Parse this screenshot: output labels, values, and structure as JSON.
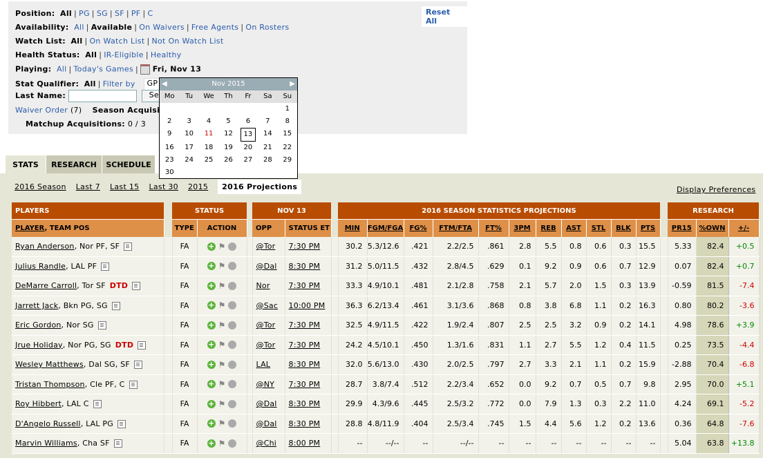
{
  "filters": {
    "position": {
      "label": "Position:",
      "current": "All",
      "options": [
        "PG",
        "SG",
        "SF",
        "PF",
        "C"
      ]
    },
    "availability": {
      "label": "Availability:",
      "all": "All",
      "current": "Available",
      "options": [
        "On Waivers",
        "Free Agents",
        "On Rosters"
      ]
    },
    "watch": {
      "label": "Watch List:",
      "current": "All",
      "options": [
        "On Watch List",
        "Not On Watch List"
      ]
    },
    "health": {
      "label": "Health Status:",
      "current": "All",
      "options": [
        "IR-Eligible",
        "Healthy"
      ]
    },
    "playing": {
      "label": "Playing:",
      "all": "All",
      "today": "Today's Games",
      "date": "Fri, Nov 13"
    },
    "qualifier": {
      "label": "Stat Qualifier:",
      "current": "All",
      "filter": "Filter by",
      "select": "GP"
    },
    "lastname": {
      "label": "Last Name:",
      "value": "",
      "button": "Search"
    },
    "waiver": {
      "link": "Waiver Order",
      "count": "(7)",
      "season": "Season Acquisitions"
    },
    "matchup": {
      "label": "Matchup Acquisitions:",
      "value": "0 / 3"
    },
    "reset": "Reset All"
  },
  "calendar": {
    "month": "Nov 2015",
    "days": [
      "Mo",
      "Tu",
      "We",
      "Th",
      "Fr",
      "Sa",
      "Su"
    ],
    "weeks": [
      [
        "",
        "",
        "",
        "",
        "",
        "",
        "1"
      ],
      [
        "2",
        "3",
        "4",
        "5",
        "6",
        "7",
        "8"
      ],
      [
        "9",
        "10",
        "11",
        "12",
        "13",
        "14",
        "15"
      ],
      [
        "16",
        "17",
        "18",
        "19",
        "20",
        "21",
        "22"
      ],
      [
        "23",
        "24",
        "25",
        "26",
        "27",
        "28",
        "29"
      ],
      [
        "30",
        "",
        "",
        "",
        "",
        "",
        ""
      ]
    ],
    "today": "11",
    "selected": "13"
  },
  "tabs": [
    "STATS",
    "RESEARCH",
    "SCHEDULE"
  ],
  "periods": [
    "2016 Season",
    "Last 7",
    "Last 15",
    "Last 30",
    "2015",
    "2016 Projections"
  ],
  "display_prefs": "Display Preferences",
  "groups": {
    "players": "PLAYERS",
    "status": "STATUS",
    "date": "NOV 13",
    "stats": "2016 SEASON STATISTICS PROJECTIONS",
    "research": "RESEARCH"
  },
  "headers": {
    "player": "PLAYER",
    "teampos": ", TEAM POS",
    "type": "TYPE",
    "action": "ACTION",
    "opp": "OPP",
    "status": "STATUS ET",
    "stats": [
      "MIN",
      "FGM/FGA",
      "FG%",
      "FTM/FTA",
      "FT%",
      "3PM",
      "REB",
      "AST",
      "STL",
      "BLK",
      "PTS"
    ],
    "research": [
      "PR15",
      "%OWN",
      "+/-"
    ]
  },
  "rows": [
    [
      "Ryan Anderson",
      ", Nor PF, SF",
      "",
      "FA",
      "@Tor",
      "7:30 PM",
      "30.2",
      "5.3/12.6",
      ".421",
      "2.2/2.5",
      ".861",
      "2.8",
      "5.5",
      "0.8",
      "0.6",
      "0.3",
      "15.5",
      "5.33",
      "82.4",
      "+0.5"
    ],
    [
      "Julius Randle",
      ", LAL PF",
      "",
      "FA",
      "@Dal",
      "8:30 PM",
      "31.2",
      "5.0/11.5",
      ".432",
      "2.8/4.5",
      ".629",
      "0.1",
      "9.2",
      "0.9",
      "0.6",
      "0.7",
      "12.9",
      "0.07",
      "82.4",
      "+0.7"
    ],
    [
      "DeMarre Carroll",
      ", Tor SF",
      "DTD",
      "FA",
      "Nor",
      "7:30 PM",
      "33.3",
      "4.9/10.1",
      ".481",
      "2.1/2.8",
      ".758",
      "2.1",
      "5.7",
      "2.0",
      "1.5",
      "0.3",
      "13.9",
      "-0.59",
      "81.5",
      "-7.4"
    ],
    [
      "Jarrett Jack",
      ", Bkn PG, SG",
      "",
      "FA",
      "@Sac",
      "10:00 PM",
      "36.3",
      "6.2/13.4",
      ".461",
      "3.1/3.6",
      ".868",
      "0.8",
      "3.8",
      "6.8",
      "1.1",
      "0.2",
      "16.3",
      "0.80",
      "80.2",
      "-3.6"
    ],
    [
      "Eric Gordon",
      ", Nor SG",
      "",
      "FA",
      "@Tor",
      "7:30 PM",
      "32.5",
      "4.9/11.5",
      ".422",
      "1.9/2.4",
      ".807",
      "2.5",
      "2.5",
      "3.2",
      "0.9",
      "0.2",
      "14.1",
      "4.98",
      "78.6",
      "+3.9"
    ],
    [
      "Jrue Holiday",
      ", Nor PG, SG",
      "DTD",
      "FA",
      "@Tor",
      "7:30 PM",
      "24.2",
      "4.5/10.1",
      ".450",
      "1.3/1.6",
      ".831",
      "1.1",
      "2.7",
      "5.5",
      "1.2",
      "0.4",
      "11.5",
      "0.25",
      "73.5",
      "-4.4"
    ],
    [
      "Wesley Matthews",
      ", Dal SG, SF",
      "",
      "FA",
      "LAL",
      "8:30 PM",
      "32.0",
      "5.6/13.0",
      ".430",
      "2.0/2.5",
      ".797",
      "2.7",
      "3.3",
      "2.1",
      "1.1",
      "0.2",
      "15.9",
      "-2.88",
      "70.4",
      "-6.8"
    ],
    [
      "Tristan Thompson",
      ", Cle PF, C",
      "",
      "FA",
      "@NY",
      "7:30 PM",
      "28.7",
      "3.8/7.4",
      ".512",
      "2.2/3.4",
      ".652",
      "0.0",
      "9.2",
      "0.7",
      "0.5",
      "0.7",
      "9.8",
      "2.95",
      "70.0",
      "+5.1"
    ],
    [
      "Roy Hibbert",
      ", LAL C",
      "",
      "FA",
      "@Dal",
      "8:30 PM",
      "29.9",
      "4.3/9.6",
      ".445",
      "2.5/3.2",
      ".772",
      "0.0",
      "7.9",
      "1.3",
      "0.3",
      "2.2",
      "11.0",
      "4.24",
      "69.1",
      "-5.2"
    ],
    [
      "D'Angelo Russell",
      ", LAL PG",
      "",
      "FA",
      "@Dal",
      "8:30 PM",
      "28.8",
      "4.8/11.9",
      ".404",
      "2.5/3.4",
      ".745",
      "1.5",
      "4.4",
      "5.6",
      "1.2",
      "0.2",
      "13.6",
      "0.36",
      "64.8",
      "-7.6"
    ],
    [
      "Marvin Williams",
      ", Cha SF",
      "",
      "FA",
      "@Chi",
      "8:00 PM",
      "--",
      "--/--",
      "--",
      "--/--",
      "--",
      "--",
      "--",
      "--",
      "--",
      "--",
      "--",
      "5.04",
      "63.8",
      "+13.8"
    ]
  ]
}
